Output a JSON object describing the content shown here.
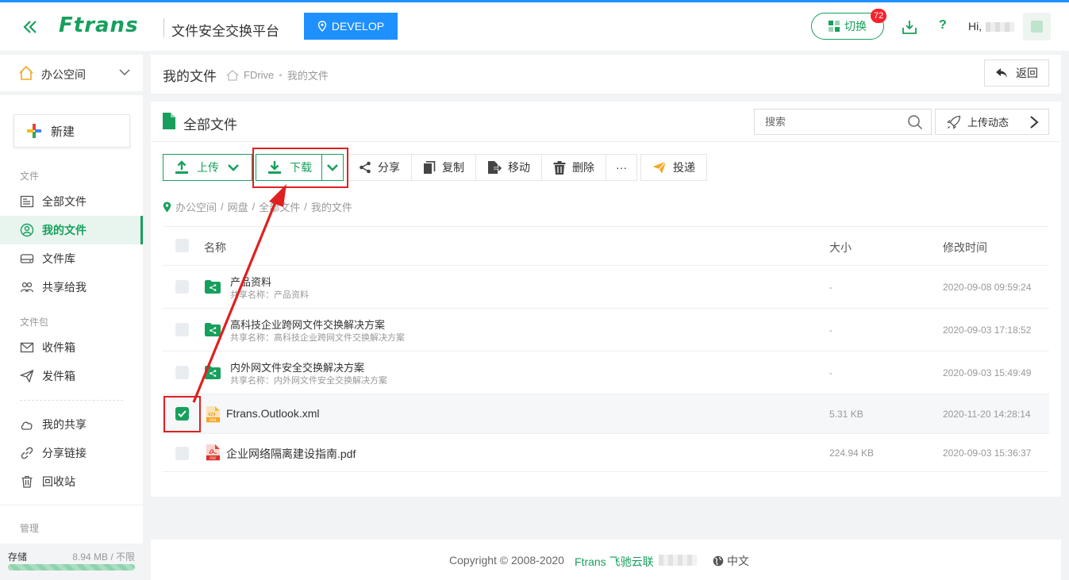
{
  "header": {
    "logo": "Ftrans",
    "platform": "文件安全交换平台",
    "env_label": "DEVELOP",
    "switch_label": "切换",
    "notify_count": "72",
    "help": "?",
    "greeting": "Hi,"
  },
  "sidebar": {
    "workspace": "办公空间",
    "new_label": "新建",
    "section_files": "文件",
    "items_files": [
      {
        "label": "全部文件"
      },
      {
        "label": "我的文件"
      },
      {
        "label": "文件库"
      },
      {
        "label": "共享给我"
      }
    ],
    "section_package": "文件包",
    "items_package": [
      {
        "label": "收件箱"
      },
      {
        "label": "发件箱"
      }
    ],
    "items_share": [
      {
        "label": "我的共享"
      },
      {
        "label": "分享链接"
      },
      {
        "label": "回收站"
      }
    ],
    "section_manage": "管理",
    "storage_label": "存储",
    "storage_value": "8.94 MB / 不限"
  },
  "breadcrumb": {
    "title": "我的文件",
    "root": "FDrive",
    "sep": "•",
    "current": "我的文件",
    "back_label": "返回"
  },
  "panel": {
    "title": "全部文件",
    "search_placeholder": "搜索",
    "upload_activity": "上传动态",
    "toolbar": {
      "upload": "上传",
      "download": "下载",
      "share": "分享",
      "copy": "复制",
      "move": "移动",
      "delete": "删除",
      "more": "···",
      "deliver": "投递"
    },
    "path": [
      "办公空间",
      "网盘",
      "全部文件",
      "我的文件"
    ],
    "path_sep": "/",
    "columns": {
      "name": "名称",
      "size": "大小",
      "modified": "修改时间"
    },
    "folders": [
      {
        "name": "产品资料",
        "share": "共享名称：产品资料",
        "size": "-",
        "time": "2020-09-08 09:59:24"
      },
      {
        "name": "高科技企业跨网文件交换解决方案",
        "share": "共享名称：高科技企业跨网文件交换解决方案",
        "size": "-",
        "time": "2020-09-03 17:18:52"
      },
      {
        "name": "内外网文件安全交换解决方案",
        "share": "共享名称：内外网文件安全交换解决方案",
        "size": "-",
        "time": "2020-09-03 15:49:49"
      }
    ],
    "files": [
      {
        "name": "Ftrans.Outlook.xml",
        "size": "5.31 KB",
        "time": "2020-11-20 14:28:14",
        "checked": true,
        "icon_text": "XML"
      },
      {
        "name": "企业网络隔离建设指南.pdf",
        "size": "224.94 KB",
        "time": "2020-09-03 15:36:37",
        "checked": false,
        "icon_text": "PDF"
      }
    ]
  },
  "footer": {
    "copyright": "Copyright © 2008-2020",
    "brand": "Ftrans 飞驰云联",
    "lang": "中文"
  },
  "colors": {
    "primary": "#17a05d",
    "accent": "#1e90ff",
    "highlight": "#e02020"
  }
}
